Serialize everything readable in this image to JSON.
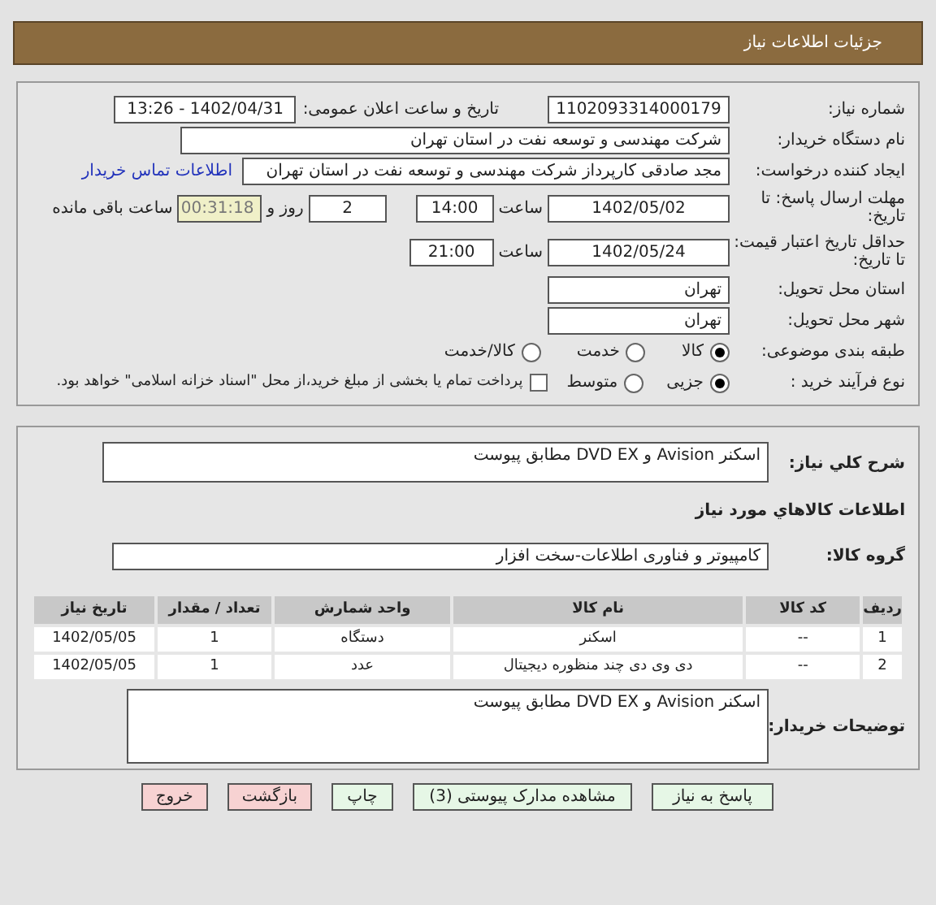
{
  "header": {
    "title": "جزئیات اطلاعات نیاز"
  },
  "info": {
    "need_number_label": "شماره نیاز:",
    "need_number": "1102093314000179",
    "announce_label": "تاریخ و ساعت اعلان عمومی:",
    "announce": "1402/04/31 - 13:26",
    "buyer_label": "نام دستگاه خریدار:",
    "buyer": "شرکت مهندسی و توسعه نفت در استان تهران",
    "creator_label": "ایجاد کننده درخواست:",
    "creator": "مجد صادقی کارپرداز شرکت مهندسی و توسعه نفت در استان تهران",
    "contact_link": "اطلاعات تماس خریدار",
    "deadline_label": "مهلت ارسال پاسخ: تا تاریخ:",
    "deadline_date": "1402/05/02",
    "time_label": "ساعت",
    "deadline_time": "14:00",
    "days": "2",
    "days_label": "روز و",
    "remaining": "00:31:18",
    "remaining_label": "ساعت باقی مانده",
    "validity_label": "حداقل تاریخ اعتبار قیمت: تا تاریخ:",
    "validity_date": "1402/05/24",
    "validity_time_label": "ساعت",
    "validity_time": "21:00",
    "province_label": "استان محل تحویل:",
    "province": "تهران",
    "city_label": "شهر محل تحویل:",
    "city": "تهران",
    "category_label": "طبقه بندی موضوعی:",
    "category_options": [
      {
        "label": "کالا",
        "selected": true
      },
      {
        "label": "خدمت",
        "selected": false
      },
      {
        "label": "کالا/خدمت",
        "selected": false
      }
    ],
    "process_label": "نوع فرآیند خرید :",
    "process_options": [
      {
        "label": "جزیی",
        "selected": true
      },
      {
        "label": "متوسط",
        "selected": false
      }
    ],
    "payment": {
      "label": "پرداخت تمام یا بخشی از مبلغ خرید،از محل \"اسناد خزانه اسلامی\" خواهد بود.",
      "checked": false
    }
  },
  "details": {
    "summary_label": "شرح کلي نیاز:",
    "summary": "اسکنر  Avision  و DVD EX مطابق پیوست",
    "goods_heading": "اطلاعات کالاهاي مورد نیاز",
    "group_label": "گروه کالا:",
    "group": "کامپیوتر و فناوری اطلاعات-سخت افزار",
    "table": {
      "columns": [
        "ردیف",
        "کد کالا",
        "نام کالا",
        "واحد شمارش",
        "تعداد / مقدار",
        "تاریخ نیاز"
      ],
      "rows": [
        [
          "1",
          "--",
          "اسکنر",
          "دستگاه",
          "1",
          "1402/05/05"
        ],
        [
          "2",
          "--",
          "دی وی دی چند منظوره دیجیتال",
          "عدد",
          "1",
          "1402/05/05"
        ]
      ]
    },
    "notes_label": "توضیحات خریدار:",
    "notes": "اسکنر  Avision  و DVD EX مطابق پیوست"
  },
  "buttons": [
    {
      "label": "پاسخ به نیاز",
      "kind": "green"
    },
    {
      "label": "مشاهده مدارک پیوستی (3)",
      "kind": "green"
    },
    {
      "label": "چاپ",
      "kind": "green"
    },
    {
      "label": "بازگشت",
      "kind": "red"
    },
    {
      "label": "خروج",
      "kind": "red"
    }
  ]
}
